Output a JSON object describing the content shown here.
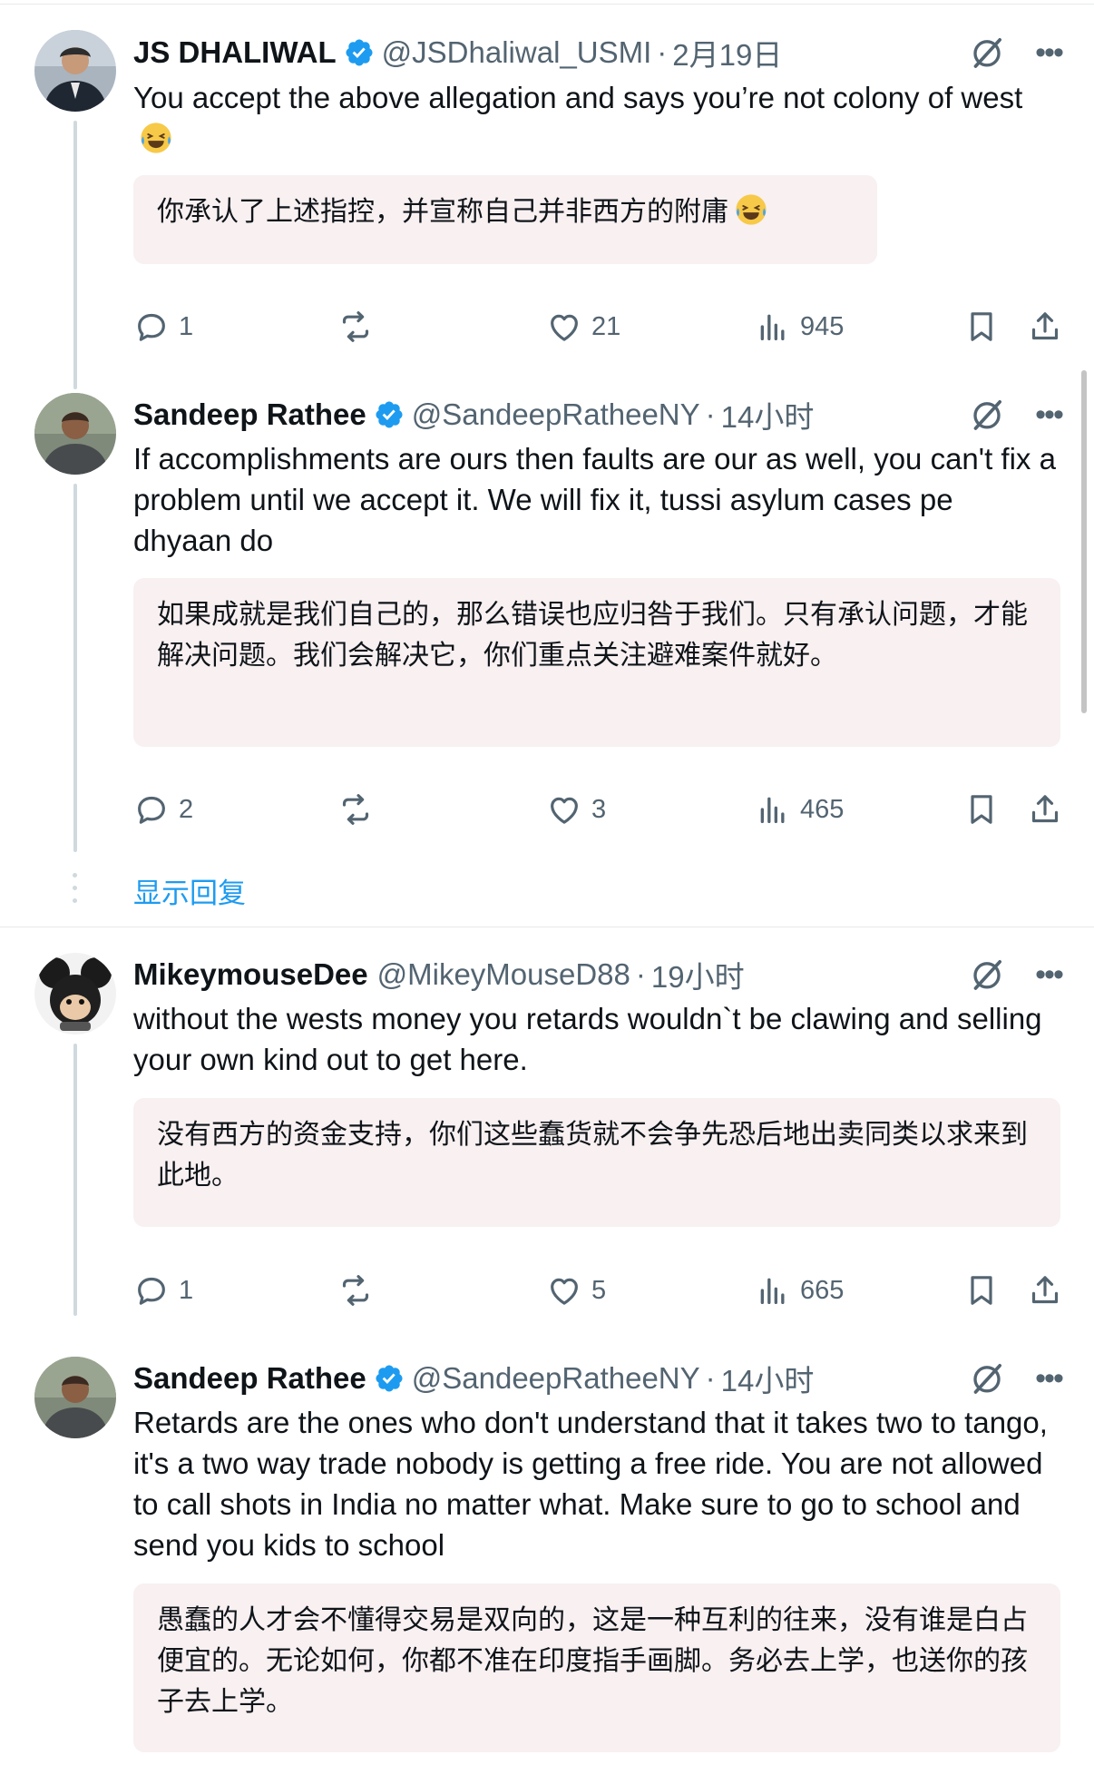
{
  "tweets": [
    {
      "name": "JS DHALIWAL",
      "handle": "@JSDhaliwal_USMI",
      "time": "2月19日",
      "text": "You accept the above allegation and says you’re not colony of west",
      "translation": "你承认了上述指控，并宣称自己并非西方的附庸",
      "emoji": "face-with-tears-of-joy",
      "replies": "1",
      "retweets": "",
      "likes": "21",
      "views": "945"
    },
    {
      "name": "Sandeep Rathee",
      "handle": "@SandeepRatheeNY",
      "time": "14小时",
      "text": "If accomplishments are ours then faults are our as well, you can't fix a problem until we accept it. We will fix it, tussi asylum cases pe dhyaan do",
      "translation": "如果成就是我们自己的，那么错误也应归咎于我们。只有承认问题，才能解决问题。我们会解决它，你们重点关注避难案件就好。",
      "replies": "2",
      "retweets": "",
      "likes": "3",
      "views": "465"
    },
    {
      "name": "MikeymouseDee",
      "handle": "@MikeyMouseD88",
      "time": "19小时",
      "text": "without the wests money you retards wouldn`t be clawing and selling your own kind out to get here.",
      "translation": "没有西方的资金支持，你们这些蠢货就不会争先恐后地出卖同类以求来到此地。",
      "replies": "1",
      "retweets": "",
      "likes": "5",
      "views": "665"
    },
    {
      "name": "Sandeep Rathee",
      "handle": "@SandeepRatheeNY",
      "time": "14小时",
      "text": "Retards are the ones who don't understand that it takes two to tango, it's a two way trade nobody is getting a free ride. You are not allowed to call shots in India no matter what. Make sure to go to school and send you kids to school",
      "translation": "愚蠢的人才会不懂得交易是双向的，这是一种互利的往来，没有谁是白占便宜的。无论如何，你都不准在印度指手画脚。务必去上学，也送你的孩子去上学。"
    }
  ],
  "show_replies": "显示回复",
  "separator": "·",
  "colors": {
    "accent": "#1d9bf0",
    "muted": "#536471",
    "translation_bg": "#f8f0f1",
    "thread_line": "#cfd9de"
  },
  "icons": [
    "verified-badge-icon",
    "grok-icon",
    "more-icon",
    "reply-icon",
    "retweet-icon",
    "like-icon",
    "views-icon",
    "bookmark-icon",
    "share-icon"
  ]
}
